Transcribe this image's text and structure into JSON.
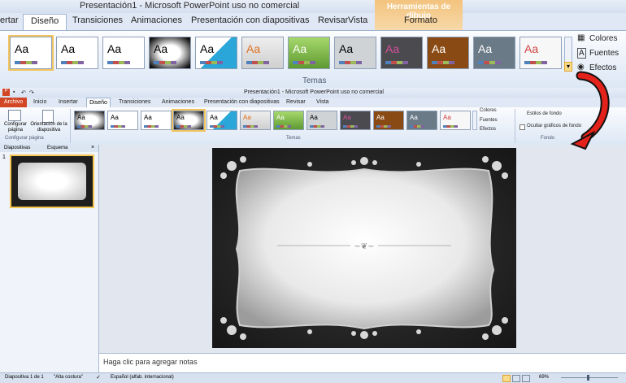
{
  "zoom": {
    "window_title": "Presentación1  -  Microsoft PowerPoint uso no comercial",
    "contextual_tab": "Herramientas de dibujo",
    "tabs": [
      "ertar",
      "Diseño",
      "Transiciones",
      "Animaciones",
      "Presentación con diapositivas",
      "Revisar",
      "Vista",
      "Formato"
    ],
    "theme_sample": "Aa",
    "right_buttons": [
      "Colores",
      "Fuentes",
      "Efectos"
    ],
    "group_label": "Temas"
  },
  "app": {
    "window_title": "Presentación1  -  Microsoft PowerPoint uso no comercial",
    "file_tab": "Archivo",
    "tabs": [
      "Inicio",
      "Insertar",
      "Diseño",
      "Transiciones",
      "Animaciones",
      "Presentación con diapositivas",
      "Revisar",
      "Vista"
    ],
    "page_setup_buttons": [
      "Configurar página",
      "Orientación de la diapositiva"
    ],
    "page_setup_group": "Configurar página",
    "themes_group": "Temas",
    "theme_buttons": [
      "Colores",
      "Fuentes",
      "Efectos"
    ],
    "background_buttons": [
      "Estilos de fondo",
      "Ocultar gráficos de fondo"
    ],
    "background_group": "Fondo",
    "panel_tabs": [
      "Diapositivas",
      "Esquema"
    ],
    "slide_number": "1",
    "notes_placeholder": "Haga clic para agregar notas",
    "status": {
      "slide_info": "Diapositiva 1 de 1",
      "theme": "\"Alta costura\"",
      "language": "Español (alfab. internacional)",
      "zoom": "69%"
    }
  }
}
